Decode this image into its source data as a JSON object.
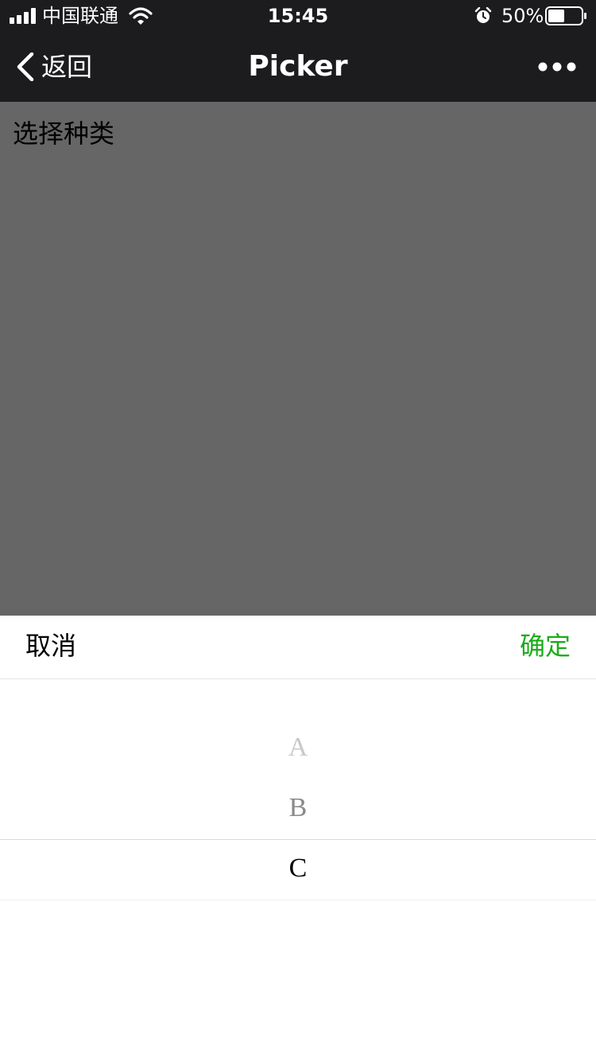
{
  "status_bar": {
    "carrier": "中国联通",
    "time": "15:45",
    "battery_percent": "50%",
    "battery_level": 0.5,
    "icons": [
      "signal-icon",
      "wifi-icon",
      "alarm-icon",
      "battery-icon"
    ]
  },
  "nav_bar": {
    "back_label": "返回",
    "title": "Picker",
    "icons": [
      "chevron-left-icon",
      "more-icon"
    ]
  },
  "page": {
    "label": "选择种类"
  },
  "picker": {
    "cancel_label": "取消",
    "confirm_label": "确定",
    "options": [
      "A",
      "B",
      "C"
    ],
    "selected": "C"
  },
  "colors": {
    "nav_background": "#1c1c1e",
    "mask_background": "#666666",
    "confirm_green": "#1aad19",
    "option_far": "#c8c8c8",
    "option_near": "#8a8a8a",
    "option_selected": "#000000"
  }
}
